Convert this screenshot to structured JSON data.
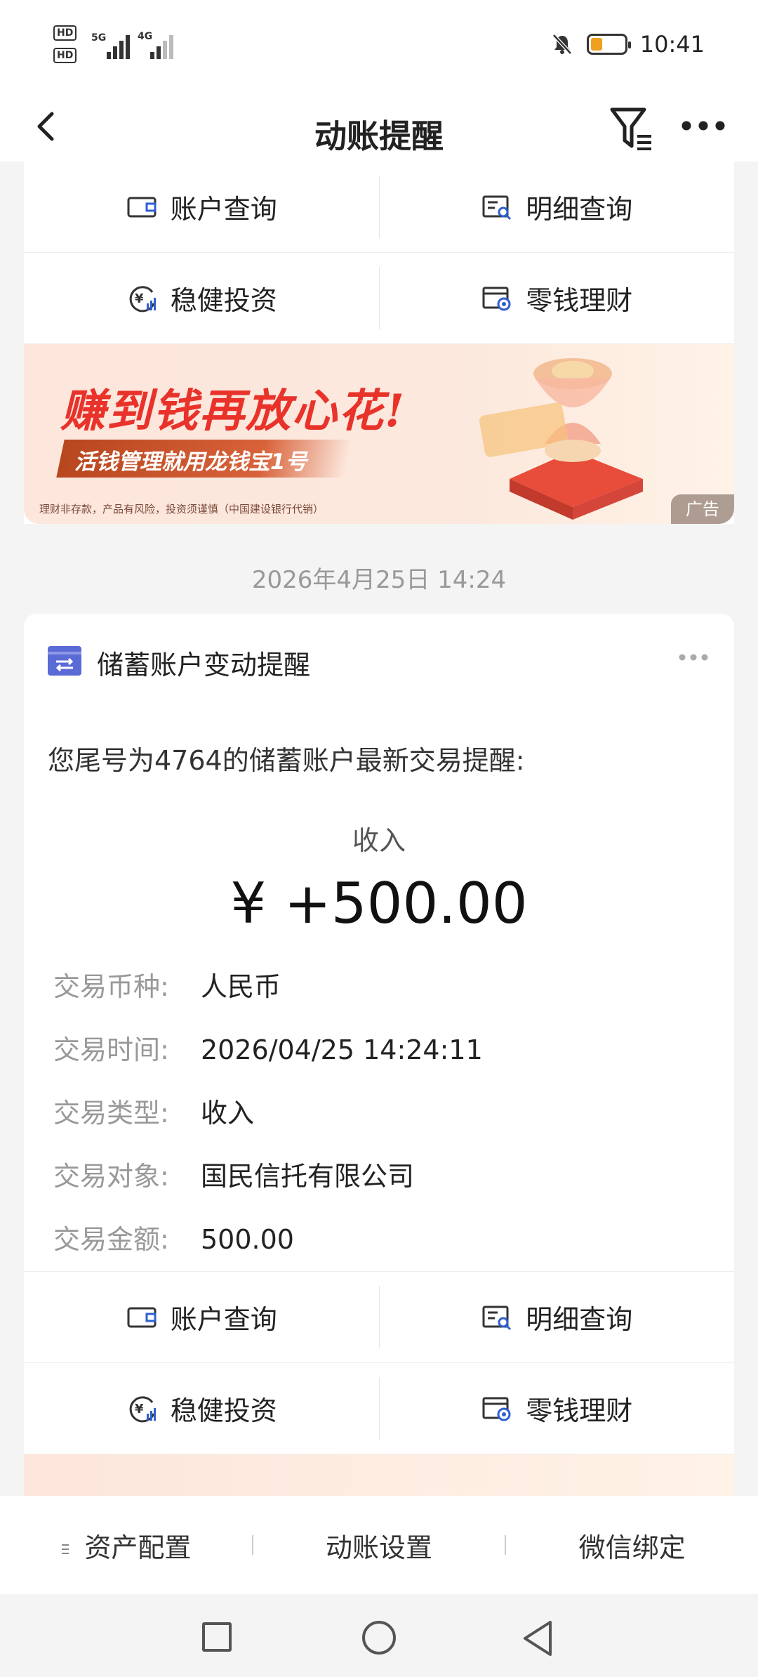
{
  "status_bar": {
    "sim1": "HD",
    "sim2": "HD",
    "net1": "5G",
    "net2": "4G",
    "time": "10:41",
    "battery_level": 0.3
  },
  "header": {
    "title": "动账提醒"
  },
  "top_actions": {
    "account_query": "账户查询",
    "detail_query": "明细查询",
    "steady_invest": "稳健投资",
    "change_wealth": "零钱理财"
  },
  "banner": {
    "headline": "赚到钱再放心花!",
    "subline": "活钱管理就用龙钱宝1号",
    "disclaimer": "理财非存款，产品有风险，投资须谨慎（中国建设银行代销）",
    "ad_tag": "广告"
  },
  "message": {
    "date": "2026年4月25日 14:24",
    "title": "储蓄账户变动提醒",
    "intro": "您尾号为4764的储蓄账户最新交易提醒:",
    "type_label": "收入",
    "amount": "¥ +500.00",
    "fields": [
      {
        "key": "交易币种:",
        "value": "人民币"
      },
      {
        "key": "交易时间:",
        "value": "2026/04/25 14:24:11"
      },
      {
        "key": "交易类型:",
        "value": "收入"
      },
      {
        "key": "交易对象:",
        "value": "国民信托有限公司"
      },
      {
        "key": "交易金额:",
        "value": "500.00"
      }
    ],
    "actions": {
      "account_query": "账户查询",
      "detail_query": "明细查询",
      "steady_invest": "稳健投资",
      "change_wealth": "零钱理财"
    }
  },
  "bottom_tabs": {
    "asset": "资产配置",
    "settings": "动账设置",
    "wechat": "微信绑定"
  },
  "colors": {
    "accent_red": "#e8322a",
    "icon_blue": "#2f5fd0",
    "icon_purple": "#5a6bd6"
  }
}
